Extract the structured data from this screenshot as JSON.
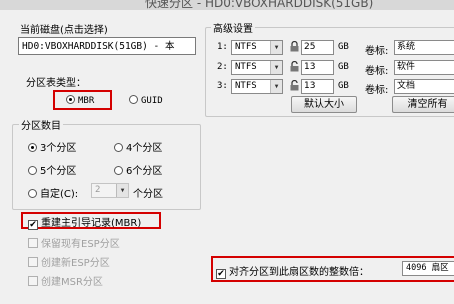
{
  "window": {
    "title": "快速分区 - HD0:VBOXHARDDISK(51GB)"
  },
  "disk": {
    "label": "当前磁盘(点击选择)",
    "value": "HD0:VBOXHARDDISK(51GB) - 本"
  },
  "partition_type": {
    "label": "分区表类型：",
    "mbr": "MBR",
    "guid": "GUID",
    "selected": "MBR"
  },
  "partition_count": {
    "label": "分区数目",
    "options": [
      "3个分区",
      "4个分区",
      "5个分区",
      "6个分区",
      "自定(C):"
    ],
    "selected": "3个分区",
    "custom_value": "2",
    "custom_suffix": "个分区"
  },
  "options": {
    "rebuild_mbr": "重建主引导记录(MBR)",
    "keep_esp": "保留现有ESP分区",
    "create_esp": "创建新ESP分区",
    "create_msr": "创建MSR分区"
  },
  "advanced": {
    "label": "高级设置",
    "rows": [
      {
        "index": "1:",
        "fs": "NTFS",
        "size": "25",
        "unit": "GB",
        "volume_label_title": "卷标:",
        "volume_label": "系统"
      },
      {
        "index": "2:",
        "fs": "NTFS",
        "size": "13",
        "unit": "GB",
        "volume_label_title": "卷标:",
        "volume_label": "软件"
      },
      {
        "index": "3:",
        "fs": "NTFS",
        "size": "13",
        "unit": "GB",
        "volume_label_title": "卷标:",
        "volume_label": "文档"
      }
    ],
    "default_size_button": "默认大小",
    "clear_all_button": "清空所有"
  },
  "align": {
    "label": "对齐分区到此扇区数的整数倍：",
    "value": "4096 扇区"
  },
  "colors": {
    "highlight": "#d40000",
    "background": "#f0f0f0"
  }
}
